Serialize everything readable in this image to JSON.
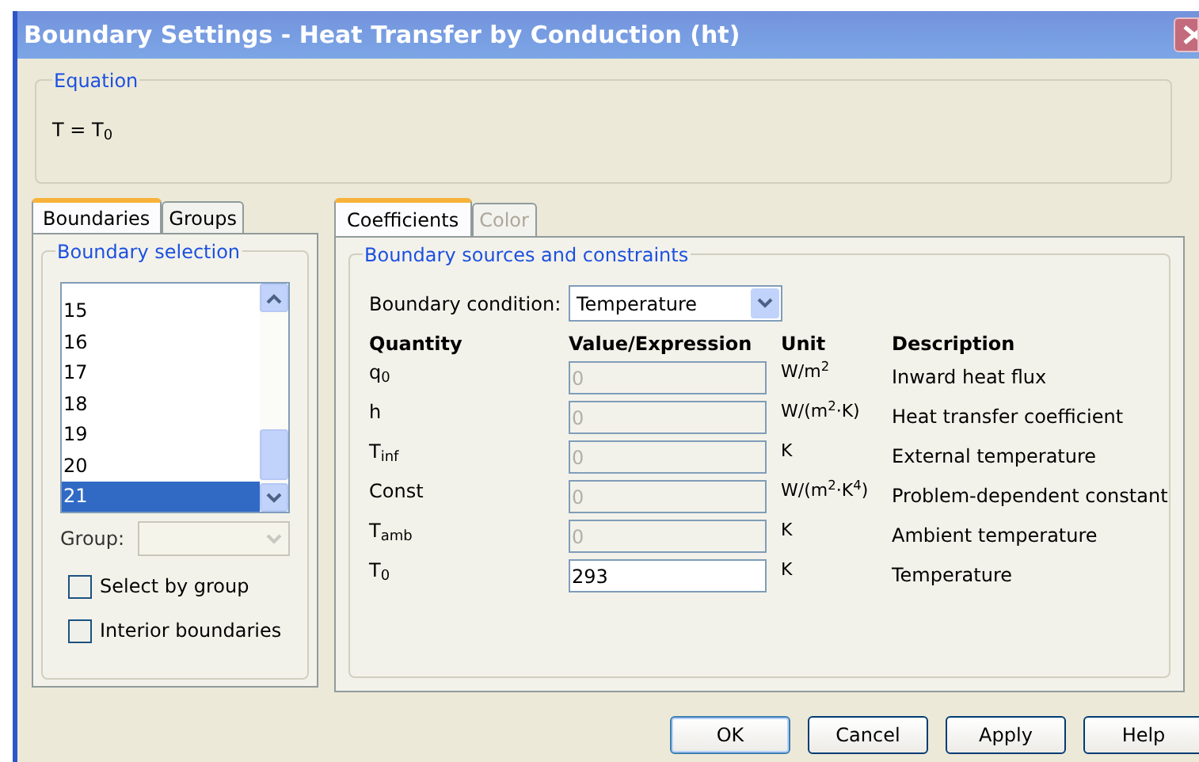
{
  "window": {
    "title": "Boundary Settings - Heat Transfer by Conduction (ht)"
  },
  "equation": {
    "title": "Equation",
    "text": "T = T$_{0}$"
  },
  "left_tabs": [
    {
      "label": "Boundaries",
      "selected": true
    },
    {
      "label": "Groups",
      "selected": false
    }
  ],
  "boundary_selection": {
    "title": "Boundary selection",
    "items": [
      {
        "label": "15",
        "selected": false
      },
      {
        "label": "16",
        "selected": false
      },
      {
        "label": "17",
        "selected": false
      },
      {
        "label": "18",
        "selected": false
      },
      {
        "label": "19",
        "selected": false
      },
      {
        "label": "20",
        "selected": false
      },
      {
        "label": "21",
        "selected": true
      }
    ],
    "group_label": "Group:",
    "group_disabled": true,
    "checkboxes": [
      {
        "label": "Select by group",
        "checked": false
      },
      {
        "label": "Interior boundaries",
        "checked": false
      }
    ]
  },
  "right_tabs": [
    {
      "label": "Coefficients",
      "selected": true,
      "disabled": false
    },
    {
      "label": "Color",
      "selected": false,
      "disabled": true
    }
  ],
  "sources": {
    "title": "Boundary sources and constraints",
    "condition_label": "Boundary condition:",
    "condition_value": "Temperature",
    "columns": [
      "Quantity",
      "Value/Expression",
      "Unit",
      "Description"
    ],
    "rows": [
      {
        "quantity": "q$_{0}$",
        "value": "0",
        "disabled": true,
        "unit": "W/m$^{2}$",
        "description": "Inward heat flux"
      },
      {
        "quantity": "h",
        "value": "0",
        "disabled": true,
        "unit": "W/(m$^{2}$·K)",
        "description": "Heat transfer coefficient"
      },
      {
        "quantity": "T$_{inf}$",
        "value": "0",
        "disabled": true,
        "unit": "K",
        "description": "External temperature"
      },
      {
        "quantity": "Const",
        "value": "0",
        "disabled": true,
        "unit": "W/(m$^{2}$·K$^{4}$)",
        "description": "Problem-dependent constant"
      },
      {
        "quantity": "T$_{amb}$",
        "value": "0",
        "disabled": true,
        "unit": "K",
        "description": "Ambient temperature"
      },
      {
        "quantity": "T$_{0}$",
        "value": "293",
        "disabled": false,
        "unit": "K",
        "description": "Temperature"
      }
    ]
  },
  "buttons": [
    {
      "label": "OK",
      "default": true
    },
    {
      "label": "Cancel",
      "default": false
    },
    {
      "label": "Apply",
      "default": false
    },
    {
      "label": "Help",
      "default": false
    }
  ]
}
